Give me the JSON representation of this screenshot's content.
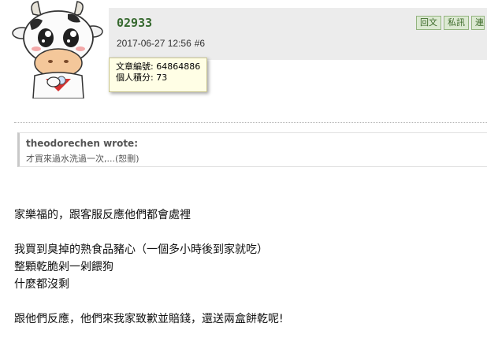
{
  "post": {
    "username": "02933",
    "date": "2017-06-27 12:56",
    "floor": "#6"
  },
  "actions": [
    {
      "label": "回文"
    },
    {
      "label": "私訊"
    },
    {
      "label": "連"
    }
  ],
  "tooltip": {
    "article_id": "文章編號: 64864886",
    "points": "個人積分: 73"
  },
  "quote": {
    "author": "theodorechen wrote:",
    "text": "才買來過水洗過一次,...(恕刪)"
  },
  "body": {
    "line1": "家樂福的，跟客服反應他們都會處裡",
    "line2": "我買到臭掉的熟食品豬心（一個多小時後到家就吃）",
    "line3": "整顆乾脆剁一剁餵狗",
    "line4": "什麼都沒剩",
    "line5": "跟他們反應，他們來我家致歉並賠錢，還送兩盒餅乾呢!"
  }
}
